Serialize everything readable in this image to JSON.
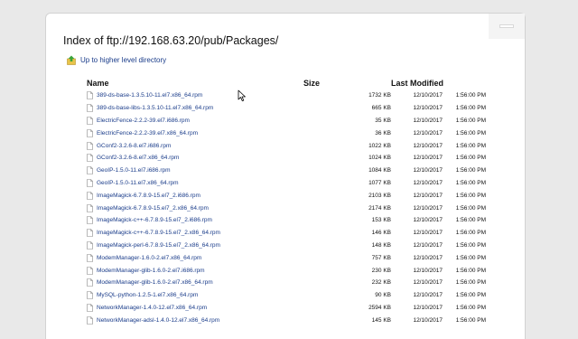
{
  "page": {
    "title": "Index of ftp://192.168.63.20/pub/Packages/",
    "up_link": "Up to higher level directory"
  },
  "columns": {
    "name": "Name",
    "size": "Size",
    "modified": "Last Modified"
  },
  "files": [
    {
      "name": "389-ds-base-1.3.5.10-11.el7.x86_64.rpm",
      "size": "1732 KB",
      "date": "12/10/2017",
      "time": "1:56:00 PM"
    },
    {
      "name": "389-ds-base-libs-1.3.5.10-11.el7.x86_64.rpm",
      "size": "665 KB",
      "date": "12/10/2017",
      "time": "1:56:00 PM"
    },
    {
      "name": "ElectricFence-2.2.2-39.el7.i686.rpm",
      "size": "35 KB",
      "date": "12/10/2017",
      "time": "1:56:00 PM"
    },
    {
      "name": "ElectricFence-2.2.2-39.el7.x86_64.rpm",
      "size": "36 KB",
      "date": "12/10/2017",
      "time": "1:56:00 PM"
    },
    {
      "name": "GConf2-3.2.6-8.el7.i686.rpm",
      "size": "1022 KB",
      "date": "12/10/2017",
      "time": "1:56:00 PM"
    },
    {
      "name": "GConf2-3.2.6-8.el7.x86_64.rpm",
      "size": "1024 KB",
      "date": "12/10/2017",
      "time": "1:56:00 PM"
    },
    {
      "name": "GeoIP-1.5.0-11.el7.i686.rpm",
      "size": "1084 KB",
      "date": "12/10/2017",
      "time": "1:56:00 PM"
    },
    {
      "name": "GeoIP-1.5.0-11.el7.x86_64.rpm",
      "size": "1077 KB",
      "date": "12/10/2017",
      "time": "1:56:00 PM"
    },
    {
      "name": "ImageMagick-6.7.8.9-15.el7_2.i686.rpm",
      "size": "2103 KB",
      "date": "12/10/2017",
      "time": "1:56:00 PM"
    },
    {
      "name": "ImageMagick-6.7.8.9-15.el7_2.x86_64.rpm",
      "size": "2174 KB",
      "date": "12/10/2017",
      "time": "1:56:00 PM"
    },
    {
      "name": "ImageMagick-c++-6.7.8.9-15.el7_2.i686.rpm",
      "size": "153 KB",
      "date": "12/10/2017",
      "time": "1:56:00 PM"
    },
    {
      "name": "ImageMagick-c++-6.7.8.9-15.el7_2.x86_64.rpm",
      "size": "146 KB",
      "date": "12/10/2017",
      "time": "1:56:00 PM"
    },
    {
      "name": "ImageMagick-perl-6.7.8.9-15.el7_2.x86_64.rpm",
      "size": "148 KB",
      "date": "12/10/2017",
      "time": "1:56:00 PM"
    },
    {
      "name": "ModemManager-1.6.0-2.el7.x86_64.rpm",
      "size": "757 KB",
      "date": "12/10/2017",
      "time": "1:56:00 PM"
    },
    {
      "name": "ModemManager-glib-1.6.0-2.el7.i686.rpm",
      "size": "230 KB",
      "date": "12/10/2017",
      "time": "1:56:00 PM"
    },
    {
      "name": "ModemManager-glib-1.6.0-2.el7.x86_64.rpm",
      "size": "232 KB",
      "date": "12/10/2017",
      "time": "1:56:00 PM"
    },
    {
      "name": "MySQL-python-1.2.5-1.el7.x86_64.rpm",
      "size": "90 KB",
      "date": "12/10/2017",
      "time": "1:56:00 PM"
    },
    {
      "name": "NetworkManager-1.4.0-12.el7.x86_64.rpm",
      "size": "2594 KB",
      "date": "12/10/2017",
      "time": "1:56:00 PM"
    },
    {
      "name": "NetworkManager-adsl-1.4.0-12.el7.x86_64.rpm",
      "size": "145 KB",
      "date": "12/10/2017",
      "time": "1:56:00 PM"
    }
  ],
  "icons": {
    "up": "folder-up-icon",
    "file": "file-icon",
    "cursor": "mouse-cursor-icon"
  },
  "colors": {
    "link": "#1a3c8a",
    "up_arrow": "#3aa33a",
    "folder": "#e8c44a"
  }
}
